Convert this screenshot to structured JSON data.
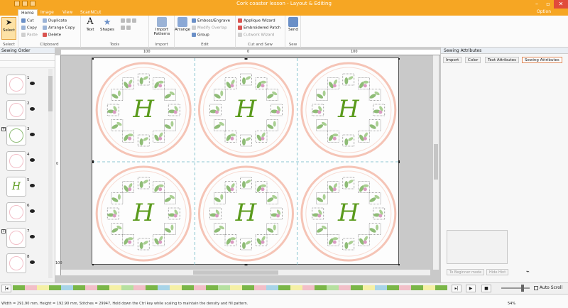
{
  "window": {
    "title": "Cork coaster lesson - Layout & Editing"
  },
  "tabs": [
    {
      "label": "Home",
      "active": true
    },
    {
      "label": "Image"
    },
    {
      "label": "View"
    },
    {
      "label": "ScanNCut"
    }
  ],
  "options_label": "Option",
  "ribbon": {
    "select": {
      "label": "Select",
      "group": "Select"
    },
    "clipboard": {
      "group": "Clipboard",
      "cut": "Cut",
      "copy": "Copy",
      "paste": "Paste",
      "duplicate": "Duplicate",
      "arrange_copy": "Arrange Copy",
      "delete": "Delete"
    },
    "tools": {
      "group": "Tools",
      "text": "Text",
      "shapes": "Shapes"
    },
    "import": {
      "group": "Import",
      "label": "Import Patterns"
    },
    "edit": {
      "group": "Edit",
      "arrange": "Arrange",
      "emboss": "Emboss/Engrave",
      "modify_overlap": "Modify Overlap",
      "group_btn": "Group"
    },
    "cutsew": {
      "group": "Cut and Sew",
      "applique": "Applique Wizard",
      "embroidered_patch": "Embroidered Patch",
      "cutwork": "Cutwork Wizard"
    },
    "sew": {
      "group": "Sew",
      "send": "Send"
    }
  },
  "sewing_order": {
    "title": "Sewing Order",
    "items": [
      {
        "num": "1"
      },
      {
        "num": "2"
      },
      {
        "num": "3"
      },
      {
        "num": "4"
      },
      {
        "num": "5"
      },
      {
        "num": "6"
      },
      {
        "num": "7"
      },
      {
        "num": "8"
      }
    ]
  },
  "ruler": {
    "h_labels": [
      "100",
      "0",
      "100"
    ],
    "v_labels": [
      "0",
      "100"
    ]
  },
  "design": {
    "letter": "H",
    "count": 6
  },
  "sewing_attributes": {
    "title": "Sewing Attributes",
    "tabs": [
      "Import",
      "Color",
      "Text Attributes",
      "Sewing Attributes"
    ],
    "beginner_btn": "To Beginner mode",
    "hide_hint": "Hide Hint"
  },
  "timeline": {
    "auto_scroll": "Auto Scroll"
  },
  "status": {
    "text": "Width = 291.90 mm, Height = 192.90 mm, Stitches = 29947, Hold down the Ctrl key while scaling to maintain the density and fill pattern.",
    "zoom": "54%"
  },
  "colors": {
    "accent": "#f6a623",
    "ring": "#f5c4b6",
    "leaf": "#8ebc76",
    "letter": "#5a9a1c",
    "flower": "#d99ac2"
  },
  "colorbar": [
    "#7ab648",
    "#f2bfc8",
    "#f5f0a6",
    "#7ab648",
    "#a8d4e8",
    "#7ab648",
    "#f2bfc8",
    "#7ab648",
    "#f5f0a6",
    "#b6e0a0",
    "#f2bfc8",
    "#7ab648",
    "#a8d4e8",
    "#f5f0a6",
    "#7ab648",
    "#f2bfc8",
    "#7ab648",
    "#b6e0a0",
    "#f5f0a6",
    "#7ab648",
    "#f2bfc8",
    "#a8d4e8",
    "#7ab648",
    "#f5f0a6",
    "#f2bfc8",
    "#7ab648",
    "#b6e0a0",
    "#f2bfc8",
    "#7ab648",
    "#f5f0a6",
    "#a8d4e8",
    "#7ab648",
    "#f2bfc8",
    "#7ab648",
    "#f5f0a6",
    "#7ab648"
  ]
}
